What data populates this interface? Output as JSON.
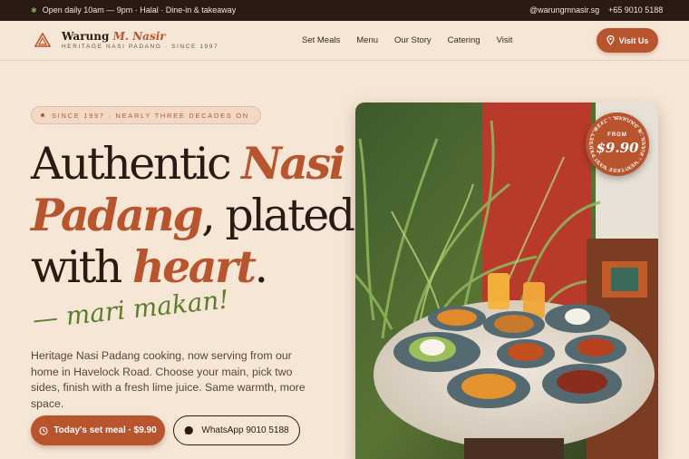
{
  "topbar": {
    "hours": "Open daily 10am — 9pm · Halal · Dine-in & takeaway",
    "instagram": "@warungmnasir.sg",
    "phone": "+65 9010 5188"
  },
  "brand": {
    "name_plain": "Warung ",
    "name_accent": "M. Nasir",
    "tagline": "HERITAGE NASI PADANG · SINCE 1997"
  },
  "nav": {
    "links": [
      "Set Meals",
      "Menu",
      "Our Story",
      "Catering",
      "Visit"
    ],
    "visit_button": "Visit Us"
  },
  "hero": {
    "pill": "SINCE 1997 · NEARLY THREE DECADES ON",
    "headline": {
      "l1a": "Authentic ",
      "l1b": "Nasi",
      "l2a": "Padang",
      "l2b": ", plated",
      "l3a": "with ",
      "l3b": "heart",
      "l3c": "."
    },
    "script": "— mari makan!",
    "description": "Heritage Nasi Padang cooking, now serving from our home in Havelock Road. Choose your main, pick two sides, finish with a fresh lime juice. Same warmth, more space.",
    "cta_primary": "Today's set meal · $9.90",
    "cta_secondary": "WhatsApp 9010 5188"
  },
  "badge": {
    "arc_text": "SET MEAL · WARUNG M. NASIR · HERITAGE NASI PADANG ·",
    "from": "FROM",
    "price": "$9.90"
  },
  "colors": {
    "accent": "#b8552f",
    "dark": "#2a1a14",
    "cream": "#f6e6d6",
    "green": "#5e7c2e"
  },
  "icons": {
    "topbar": "leaf-dot-icon",
    "visit": "map-pin-icon",
    "cta_primary": "clock-icon",
    "cta_secondary": "whatsapp-icon",
    "brand": "triangle-logo-icon"
  }
}
